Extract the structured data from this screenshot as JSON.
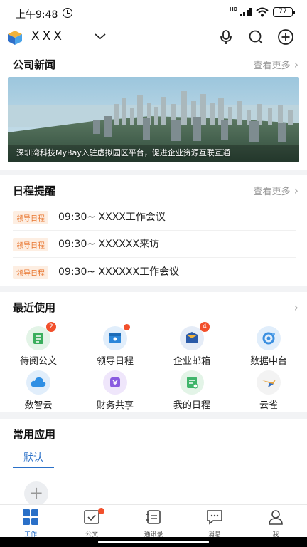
{
  "status_bar": {
    "time": "上午9:48",
    "network": "HD",
    "battery": "77"
  },
  "header": {
    "org_name": "XXX",
    "icons": [
      "microphone-icon",
      "search-icon",
      "add-circle-icon"
    ]
  },
  "news": {
    "title": "公司新闻",
    "more": "查看更多",
    "banner_caption": "深圳湾科技MyBay入驻虚拟园区平台，促进企业资源互联互通"
  },
  "schedule": {
    "title": "日程提醒",
    "more": "查看更多",
    "items": [
      {
        "tag": "领导日程",
        "text": "09:30~ XXXX工作会议"
      },
      {
        "tag": "领导日程",
        "text": "09:30~ XXXXXX来访"
      },
      {
        "tag": "领导日程",
        "text": "09:30~ XXXXXX工作会议"
      }
    ]
  },
  "recent": {
    "title": "最近使用",
    "apps": [
      {
        "label": "待阅公文",
        "icon": "document-icon",
        "badge": "2",
        "color": "#3aae5c"
      },
      {
        "label": "领导日程",
        "icon": "calendar-user-icon",
        "badge": "",
        "dot": true,
        "color": "#2b86d9"
      },
      {
        "label": "企业邮箱",
        "icon": "mail-box-icon",
        "badge": "4",
        "color": "#2a5aa8"
      },
      {
        "label": "数据中台",
        "icon": "data-hub-icon",
        "badge": "",
        "color": "#3b8fe0"
      },
      {
        "label": "数智云",
        "icon": "cloud-icon",
        "badge": "",
        "color": "#2f8fe4"
      },
      {
        "label": "财务共享",
        "icon": "finance-icon",
        "badge": "",
        "color": "#8a5be0"
      },
      {
        "label": "我的日程",
        "icon": "my-schedule-icon",
        "badge": "",
        "color": "#3fb56a"
      },
      {
        "label": "云雀",
        "icon": "lark-bird-icon",
        "badge": "",
        "color": "#e8a23a"
      }
    ]
  },
  "common_apps": {
    "title": "常用应用",
    "tab_default": "默认",
    "add_label": "+"
  },
  "bottom_nav": [
    {
      "label": "工作",
      "icon": "grid-icon",
      "active": true
    },
    {
      "label": "公文",
      "icon": "document-check-icon",
      "dot": true
    },
    {
      "label": "通讯录",
      "icon": "contacts-icon"
    },
    {
      "label": "消息",
      "icon": "message-icon"
    },
    {
      "label": "我",
      "icon": "user-icon"
    }
  ]
}
